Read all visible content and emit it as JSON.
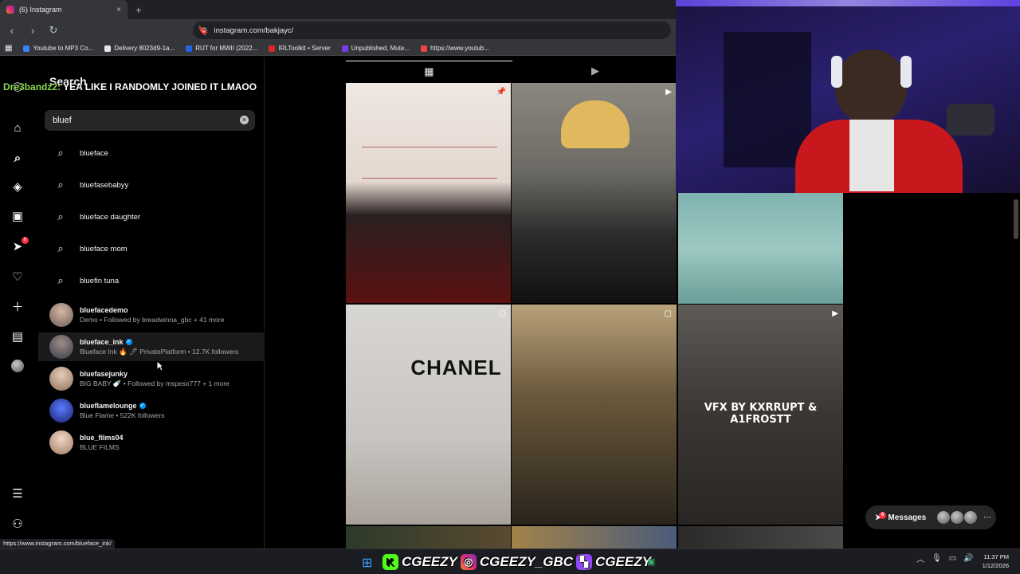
{
  "browser": {
    "tab_title": "(6) Instagram",
    "tab_close": "×",
    "new_tab": "+",
    "url": "instagram.com/bakjayc/",
    "bookmarks": [
      {
        "label": "Youtube to MP3 Co...",
        "color": "#3b82f6"
      },
      {
        "label": "Delivery 8023d9-1a...",
        "color": "#e5e7eb"
      },
      {
        "label": "RUT for MWII (2022...",
        "color": "#2563eb"
      },
      {
        "label": "IRLToolkit • Server",
        "color": "#dc2626"
      },
      {
        "label": "Unpublished, Mute...",
        "color": "#7c3aed"
      },
      {
        "label": "https://www.youtub...",
        "color": "#ef4444"
      }
    ]
  },
  "chat": {
    "user": "Dre3bandz2:",
    "message": "YEA LIKE I RANDOMLY JOINED IT LMAOO"
  },
  "search": {
    "title": "Search",
    "query": "bluef",
    "suggestions": [
      "blueface",
      "bluefasebabyy",
      "blueface daughter",
      "blueface mom",
      "bluefin tuna"
    ],
    "accounts": [
      {
        "username": "bluefacedemo",
        "subtitle": "Demo • Followed by breadwinna_gbc + 41 more",
        "verified": false,
        "color": "#6b5b55"
      },
      {
        "username": "blueface_ink",
        "subtitle": "Blueface Ink 🔥 🖊 PrivatePlatform • 12.7K followers",
        "verified": true,
        "color": "#4a4a58"
      },
      {
        "username": "bluefasejunky",
        "subtitle": "BIG BABY 🍼 • Followed by mspeso777 + 1 more",
        "verified": false,
        "color": "#8b6f5a"
      },
      {
        "username": "blueflamelounge",
        "subtitle": "Blue Flame • 522K followers",
        "verified": true,
        "color": "#2b3a8f"
      },
      {
        "username": "blue_films04",
        "subtitle": "BLUE FILMS",
        "verified": false,
        "color": "#c9a38c"
      }
    ]
  },
  "rail": {
    "notification_count": "6"
  },
  "grid": {
    "tiles": [
      {
        "caption": "",
        "bg": "linear-gradient(180deg,#efe7e1 0%,#e3d7cf 45%,#2a2020 60%,#5a1010 100%)",
        "icon": "📌"
      },
      {
        "caption": "",
        "bg": "linear-gradient(180deg,#8a8880 0%,#6c6a64 40%,#2a2a2a 70%,#111 100%)",
        "icon": "▶"
      },
      {
        "caption": "",
        "bg": "linear-gradient(180deg,#7fb3b0 0%,#9cc8c2 50%,#6a9e98 100%)",
        "icon": ""
      },
      {
        "caption": "CHANEL",
        "bg": "linear-gradient(180deg,#d8d6d3 0%,#c8c5c2 60%,#a9a29a 100%)",
        "icon": "▢"
      },
      {
        "caption": "",
        "bg": "linear-gradient(180deg,#b9a27a 0%,#6b5a3c 40%,#2a241c 100%)",
        "icon": "▢"
      },
      {
        "caption": "VFX BY KXRRUPT & A1FROSTT",
        "bg": "linear-gradient(180deg,#5e5a58 0%,#3a3634 50%,#2a2624 100%)",
        "icon": "▶"
      }
    ]
  },
  "messages": {
    "label": "Messages",
    "count": "6"
  },
  "status_url": "https://www.instagram.com/blueface_ink/",
  "taskbar": {
    "handle1": "CGEEZY",
    "handle2": "CGEEZY_GBC",
    "handle3": "CGEEZY",
    "time": "11:37 PM",
    "date": "1/12/2026"
  }
}
